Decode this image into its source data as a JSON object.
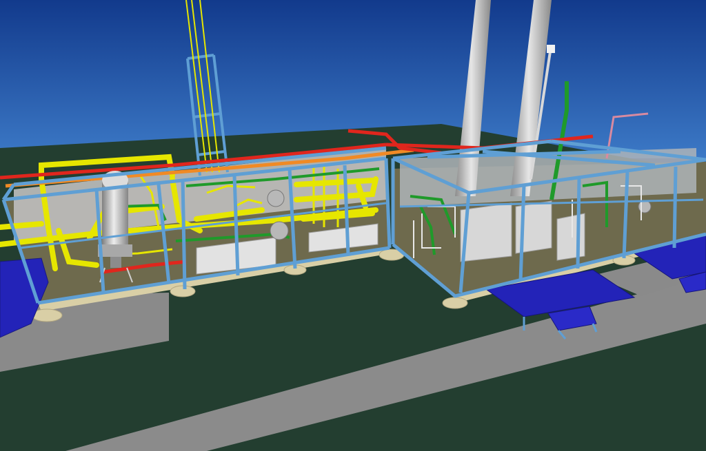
{
  "scene": {
    "kind": "3d-plant-model-render",
    "colors": {
      "sky_top": "#123a8c",
      "sky_bottom": "#3c79c6",
      "ground": "#233e30",
      "road": "#8a8a8a",
      "platform": "#d9cfa6",
      "frame": "#5f9fd4",
      "pipe_yellow": "#e6e600",
      "pipe_green": "#1f9a2a",
      "pipe_red": "#e0261d",
      "pipe_orange": "#f08a25",
      "chimney": "#c9c9c9",
      "cabinet": "#d7d7d7",
      "stair_blue": "#2323b8",
      "pipe_pink": "#d88aa0"
    },
    "icons": [
      "chimney",
      "antenna-mast",
      "column-vessel",
      "stair-platform",
      "lamp-post"
    ]
  }
}
